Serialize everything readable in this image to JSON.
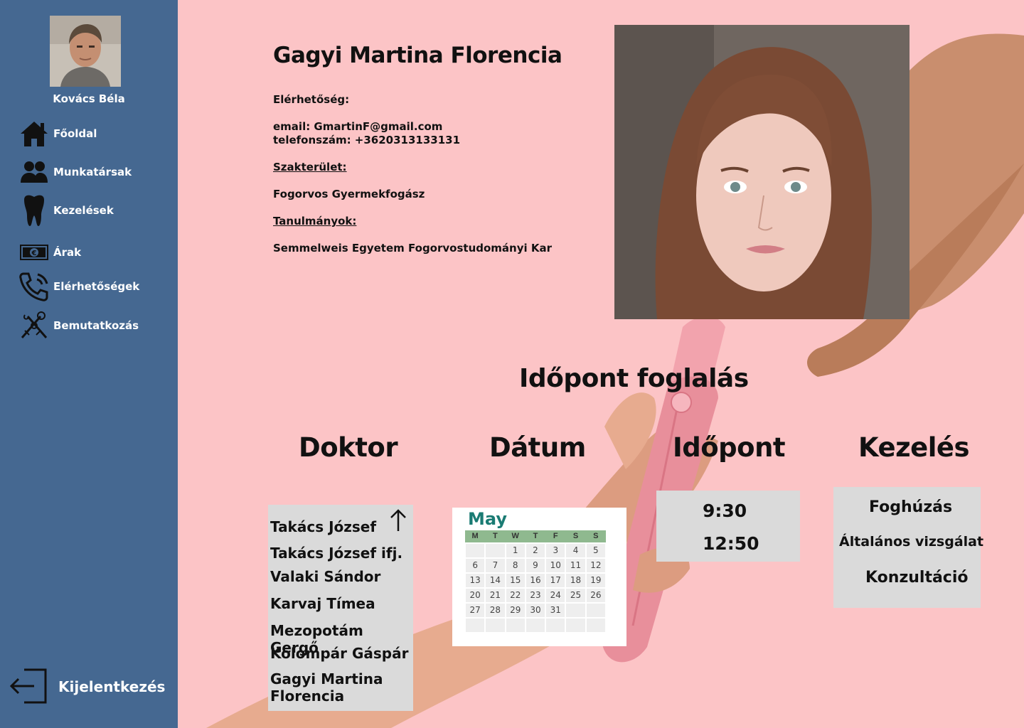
{
  "sidebar": {
    "user_name": "Kovács Béla",
    "items": [
      {
        "label": "Főoldal",
        "icon": "home-icon"
      },
      {
        "label": "Munkatársak",
        "icon": "people-icon"
      },
      {
        "label": "Kezelések",
        "icon": "tooth-icon"
      },
      {
        "label": "Árak",
        "icon": "money-icon"
      },
      {
        "label": "Elérhetőségek",
        "icon": "phone-icon"
      },
      {
        "label": "Bemutatkozás",
        "icon": "dental-tools-icon"
      }
    ],
    "logout_label": "Kijelentkezés"
  },
  "profile": {
    "name": "Gagyi Martina Florencia",
    "contact_heading": "Elérhetőség:",
    "email": "email: GmartinF@gmail.com",
    "phone": "telefonszám: +3620313133131",
    "specialty_heading": "Szakterület:",
    "specialty": "Fogorvos Gyermekfogász",
    "studies_heading": "Tanulmányok:",
    "studies": "Semmelweis Egyetem Fogorvostudományi Kar"
  },
  "booking": {
    "title": "Időpont foglalás",
    "columns": {
      "doctor": "Doktor",
      "date": "Dátum",
      "time": "Időpont",
      "treatment": "Kezelés"
    },
    "doctors": [
      "Takács József",
      "Takács József ifj.",
      "Valaki Sándor",
      "Karvaj Tímea",
      "Mezopotám Gergő",
      "Kolompár Gáspár",
      "Gagyi Martina",
      "Florencia"
    ],
    "calendar": {
      "month": "May",
      "weekdays": [
        "M",
        "T",
        "W",
        "T",
        "F",
        "S",
        "S"
      ],
      "weeks": [
        [
          "",
          "",
          "1",
          "2",
          "3",
          "4",
          "5"
        ],
        [
          "6",
          "7",
          "8",
          "9",
          "10",
          "11",
          "12"
        ],
        [
          "13",
          "14",
          "15",
          "16",
          "17",
          "18",
          "19"
        ],
        [
          "20",
          "21",
          "22",
          "23",
          "24",
          "25",
          "26"
        ],
        [
          "27",
          "28",
          "29",
          "30",
          "31",
          "",
          ""
        ],
        [
          "",
          "",
          "",
          "",
          "",
          "",
          ""
        ]
      ]
    },
    "times": [
      "9:30",
      "12:50"
    ],
    "treatments": [
      "Foghúzás",
      "Általános vizsgálat",
      "Konzultáció"
    ]
  },
  "colors": {
    "sidebar": "#456891",
    "background": "#fcc4c6",
    "panel": "#dadada",
    "calendar_header": "#8fb98f",
    "calendar_month": "#1a7b73"
  }
}
